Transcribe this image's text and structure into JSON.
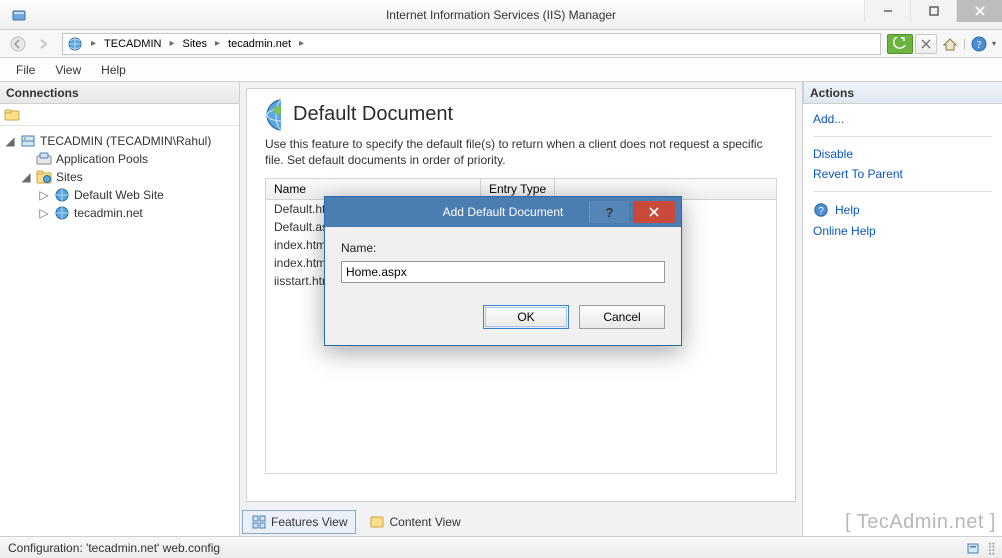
{
  "window": {
    "title": "Internet Information Services (IIS) Manager"
  },
  "breadcrumb": {
    "root": "TECADMIN",
    "level1": "Sites",
    "leaf": "tecadmin.net"
  },
  "menu": {
    "file": "File",
    "view": "View",
    "help": "Help"
  },
  "panels": {
    "connections": "Connections",
    "actions": "Actions"
  },
  "tree": {
    "server": "TECADMIN (TECADMIN\\Rahul)",
    "app_pools": "Application Pools",
    "sites": "Sites",
    "site_default": "Default Web Site",
    "site_tecadmin": "tecadmin.net"
  },
  "feature": {
    "title": "Default Document",
    "desc": "Use this feature to specify the default file(s) to return when a client does not request a specific file. Set default documents in order of priority.",
    "columns": {
      "name": "Name",
      "entry_type": "Entry Type"
    },
    "rows": [
      "Default.htm",
      "Default.asp",
      "index.htm",
      "index.html",
      "iisstart.htm"
    ]
  },
  "view_tabs": {
    "features": "Features View",
    "content": "Content View"
  },
  "actions": {
    "add": "Add...",
    "disable": "Disable",
    "revert": "Revert To Parent",
    "help": "Help",
    "online_help": "Online Help"
  },
  "dialog": {
    "title": "Add Default Document",
    "name_label": "Name:",
    "name_value": "Home.aspx",
    "ok": "OK",
    "cancel": "Cancel"
  },
  "status": {
    "text": "Configuration: 'tecadmin.net' web.config"
  },
  "watermark": "[ TecAdmin.net ]"
}
